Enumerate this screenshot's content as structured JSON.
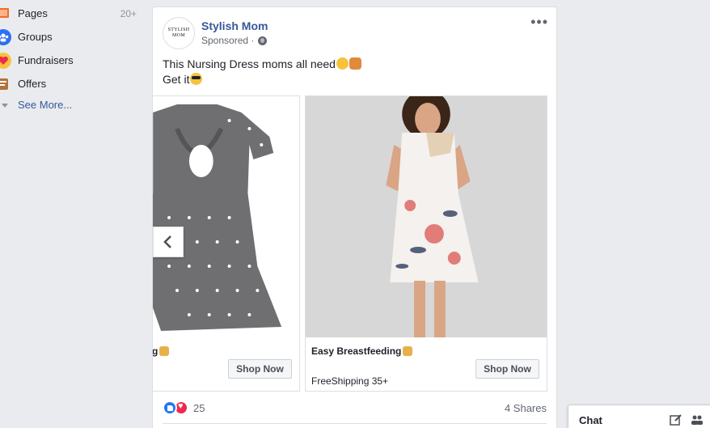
{
  "sidebar": {
    "items": [
      {
        "label": "Pages",
        "count": "20+",
        "icon": "flag-icon",
        "color": "#f36a2b"
      },
      {
        "label": "Groups",
        "count": "",
        "icon": "groups-icon",
        "color": "#2e6ff3"
      },
      {
        "label": "Fundraisers",
        "count": "",
        "icon": "heart-icon",
        "color": "#f0284a"
      },
      {
        "label": "Offers",
        "count": "",
        "icon": "offers-icon",
        "color": "#b3713b"
      }
    ],
    "see_more": "See More..."
  },
  "post": {
    "page_name": "Stylish Mom",
    "avatar_text_line1": "STYLISH",
    "avatar_text_line2": "MOM",
    "sponsored": "Sponsored ·",
    "caption_line1": "This Nursing Dress moms all need",
    "caption_line2": "Get it",
    "carousel": [
      {
        "title": "g",
        "subtitle": "",
        "button": "Shop Now"
      },
      {
        "title": "Easy Breastfeeding",
        "subtitle": "FreeShipping 35+",
        "button": "Shop Now"
      }
    ],
    "reaction_count": "25",
    "shares": "4 Shares"
  },
  "chat": {
    "label": "Chat"
  },
  "colors": {
    "link_blue": "#385898",
    "background": "#e9ebee"
  }
}
